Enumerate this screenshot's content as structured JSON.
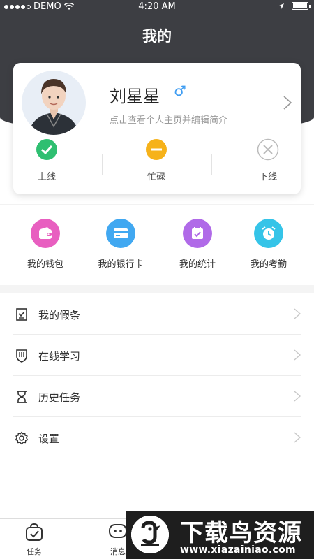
{
  "status_bar": {
    "carrier": "DEMO",
    "time": "4:20 AM",
    "battery_percent": 100,
    "icons": [
      "signal-dots-icon",
      "wifi-icon",
      "location-arrow-icon",
      "battery-icon"
    ]
  },
  "header": {
    "title": "我的"
  },
  "profile": {
    "name": "刘星星",
    "gender_symbol": "♂",
    "hint": "点击查看个人主页并编辑简介",
    "avatar_icon": "user-avatar"
  },
  "presence": {
    "options": [
      {
        "label": "上线",
        "icon": "check-circle-icon",
        "color": "#2fbf71"
      },
      {
        "label": "忙碌",
        "icon": "minus-circle-icon",
        "color": "#f6b21a"
      },
      {
        "label": "下线",
        "icon": "close-circle-icon",
        "color": "#bbbbbb"
      }
    ]
  },
  "quick_menu": {
    "items": [
      {
        "label": "我的钱包",
        "icon": "wallet-icon",
        "color": "#e85fc0"
      },
      {
        "label": "我的银行卡",
        "icon": "bank-card-icon",
        "color": "#41a8f1"
      },
      {
        "label": "我的统计",
        "icon": "calendar-stats-icon",
        "color": "#b06ae8"
      },
      {
        "label": "我的考勤",
        "icon": "alarm-clock-icon",
        "color": "#35c4e8"
      }
    ]
  },
  "list_menu": {
    "items": [
      {
        "label": "我的假条",
        "icon": "leave-note-icon"
      },
      {
        "label": "在线学习",
        "icon": "shield-book-icon"
      },
      {
        "label": "历史任务",
        "icon": "hourglass-icon"
      },
      {
        "label": "设置",
        "icon": "gear-icon"
      }
    ]
  },
  "tabbar": {
    "items": [
      {
        "label": "任务",
        "icon": "task-bag-icon"
      },
      {
        "label": "消息",
        "icon": "message-icon"
      }
    ]
  },
  "watermark": {
    "title": "下载鸟资源",
    "url": "www.xiazainiao.com"
  }
}
